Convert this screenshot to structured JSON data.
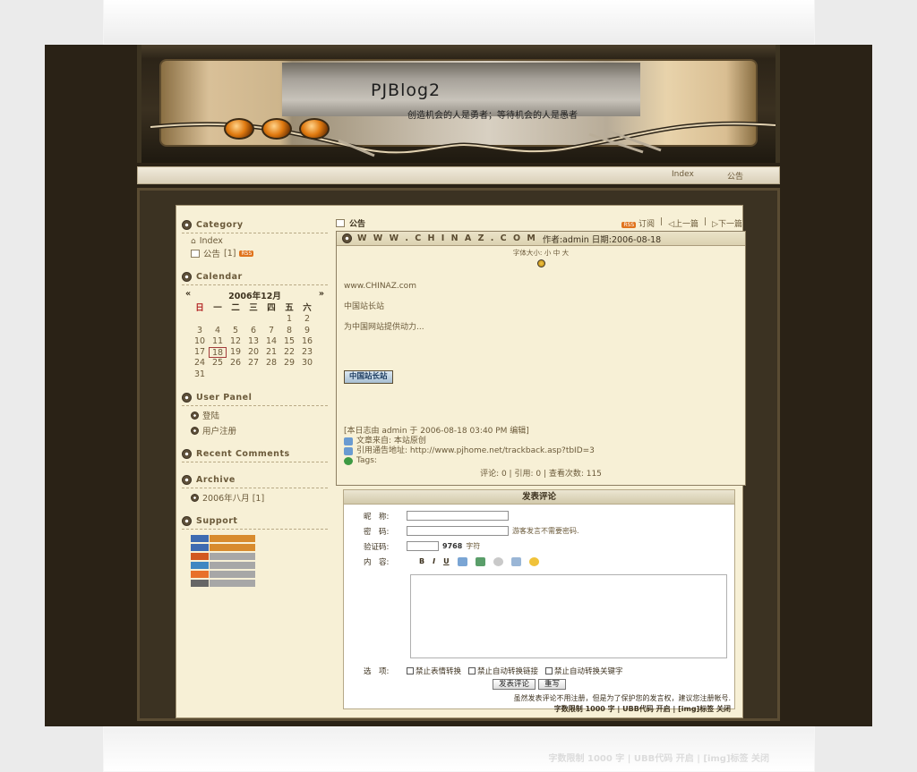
{
  "header": {
    "title": "PJBlog2",
    "subtitle": "创造机会的人是勇者；等待机会的人是愚者"
  },
  "nav": {
    "index": "Index",
    "notice": "公告"
  },
  "sidebar": {
    "category": {
      "title": "Category",
      "items": [
        {
          "label": "Index",
          "count": ""
        },
        {
          "label": "公告",
          "count": "[1]"
        }
      ]
    },
    "calendar": {
      "title": "Calendar",
      "prev": "«",
      "next": "»",
      "month": "2006年12月",
      "weekdays": [
        "日",
        "一",
        "二",
        "三",
        "四",
        "五",
        "六"
      ],
      "days": [
        "",
        "",
        "",
        "",
        "",
        "1",
        "2",
        "3",
        "4",
        "5",
        "6",
        "7",
        "8",
        "9",
        "10",
        "11",
        "12",
        "13",
        "14",
        "15",
        "16",
        "17",
        "18",
        "19",
        "20",
        "21",
        "22",
        "23",
        "24",
        "25",
        "26",
        "27",
        "28",
        "29",
        "30",
        "31"
      ],
      "today": "18"
    },
    "user_panel": {
      "title": "User Panel",
      "login": "登陆",
      "register": "用户注册"
    },
    "recent_comments": {
      "title": "Recent Comments"
    },
    "archive": {
      "title": "Archive",
      "item": "2006年八月 [1]"
    },
    "support": {
      "title": "Support"
    }
  },
  "main": {
    "section": "公告",
    "subscribe": "订阅",
    "prev": "上一篇",
    "next": "下一篇",
    "post": {
      "title": "W W W . C H I N A Z . C O M",
      "author_date": "作者:admin 日期:2006-08-18",
      "font_size": "字体大小: 小 中 大",
      "line1": "www.CHINAZ.com",
      "line2": "中国站长站",
      "line3": "为中国网站提供动力...",
      "button": "中国站长站",
      "edited": "[本日志由 admin 于 2006-08-18 03:40 PM 编辑]",
      "source": "文章来自: 本站原创",
      "trackback": "引用通告地址: http://www.pjhome.net/trackback.asp?tbID=3",
      "tags": "Tags:",
      "stats": "评论: 0 | 引用: 0 | 查看次数: 115"
    },
    "comment_form": {
      "title": "发表评论",
      "nickname_label": "昵　称:",
      "password_label": "密　码:",
      "password_hint": "游客发言不需要密码.",
      "captcha_label": "验证码:",
      "captcha_hint": "字符",
      "content_label": "内　容:",
      "tool_bold": "B",
      "tool_italic": "I",
      "tool_underline": "U",
      "options_label": "选　项:",
      "opt1": "禁止表情转换",
      "opt2": "禁止自动转换链接",
      "opt3": "禁止自动转换关键字",
      "submit": "发表评论",
      "reset": "重写",
      "note1": "虽然发表评论不用注册，但是为了保护您的发言权，建议您注册帐号.",
      "note2": "字数限制 1000 字 | UBB代码 开启 | [img]标签 关闭"
    }
  },
  "ghost": {
    "line1": "字数限制 1000 字 | UBB代码 开启 | [img]标签 关闭"
  }
}
